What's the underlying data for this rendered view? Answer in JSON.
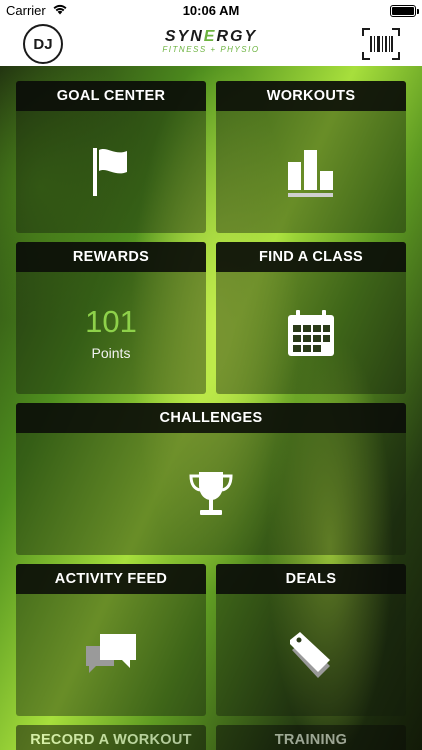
{
  "status_bar": {
    "carrier": "Carrier",
    "time": "10:06 AM",
    "wifi_icon": "wifi-icon",
    "battery_icon": "battery-icon",
    "battery_level": 1.0
  },
  "header": {
    "avatar_initials": "DJ",
    "logo_line1_a": "SYN",
    "logo_line1_accent": "E",
    "logo_line1_b": "RGY",
    "logo_line2": "FITNESS + PHYSIO",
    "barcode_icon": "barcode-icon"
  },
  "tiles": {
    "goal_center": {
      "label": "GOAL CENTER",
      "icon": "flag-icon"
    },
    "workouts": {
      "label": "WORKOUTS",
      "icon": "bar-chart-icon"
    },
    "rewards": {
      "label": "REWARDS",
      "value": "101",
      "unit": "Points"
    },
    "find_a_class": {
      "label": "FIND A CLASS",
      "icon": "calendar-icon"
    },
    "challenges": {
      "label": "CHALLENGES",
      "icon": "trophy-icon"
    },
    "activity_feed": {
      "label": "ACTIVITY FEED",
      "icon": "chat-bubbles-icon"
    },
    "deals": {
      "label": "DEALS",
      "icon": "tags-icon"
    },
    "record_a_workout": {
      "label": "RECORD A WORKOUT"
    },
    "training": {
      "label": "TRAINING"
    }
  },
  "colors": {
    "accent_green": "#6cb33f",
    "points_green": "#8ed14a",
    "tile_header_bg": "#0a0c08"
  }
}
